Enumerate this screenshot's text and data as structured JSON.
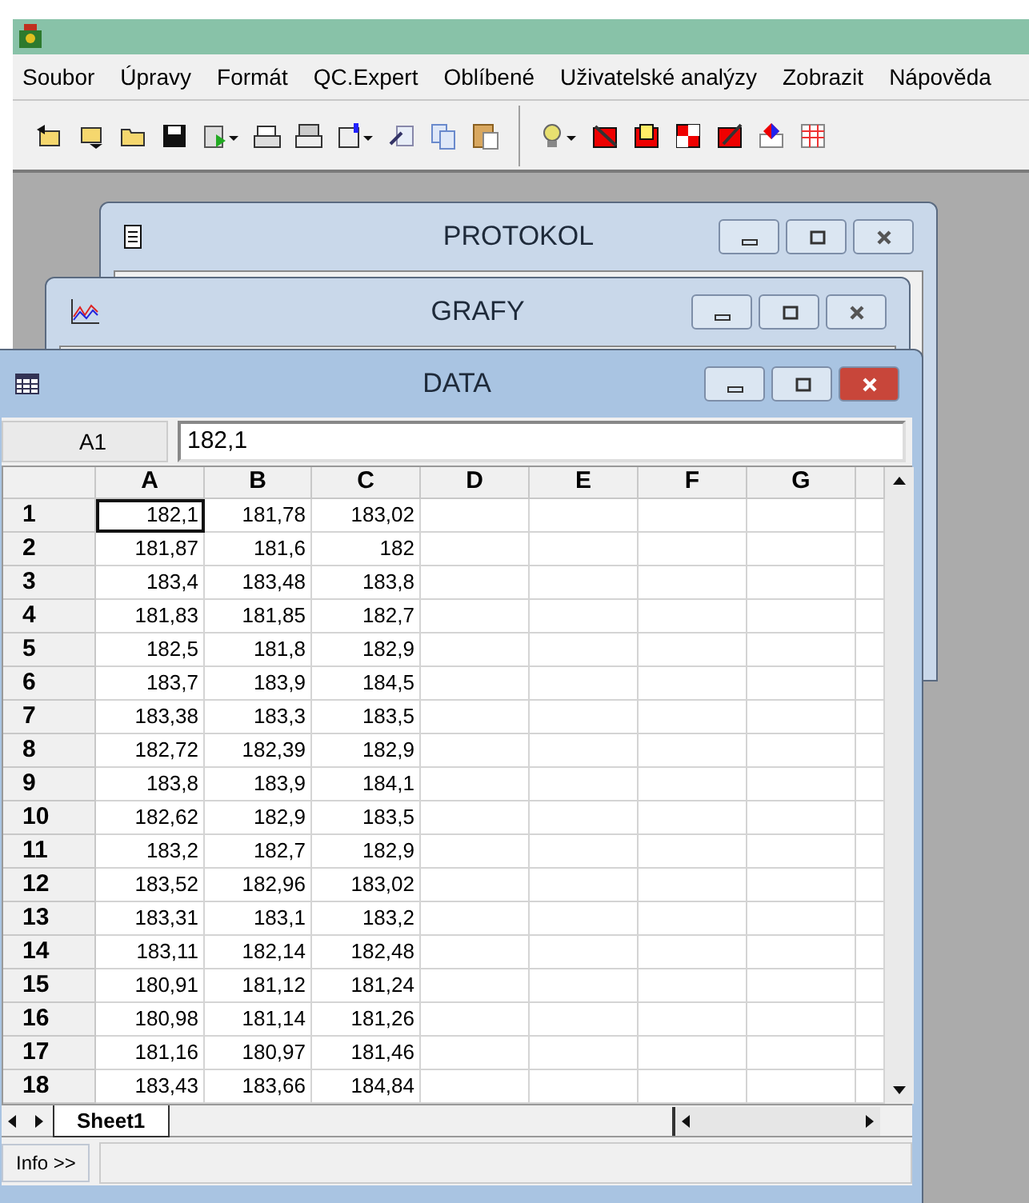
{
  "menu": [
    "Soubor",
    "Úpravy",
    "Formát",
    "QC.Expert",
    "Oblíbené",
    "Uživatelské analýzy",
    "Zobrazit",
    "Nápověda"
  ],
  "windows": [
    {
      "title": "PROTOKOL",
      "active": false
    },
    {
      "title": "GRAFY",
      "active": false
    },
    {
      "title": "DATA",
      "active": true
    }
  ],
  "sheet": {
    "name_box": "A1",
    "formula": "182,1",
    "columns": [
      "A",
      "B",
      "C",
      "D",
      "E",
      "F",
      "G"
    ],
    "rows": [
      {
        "header": "1",
        "cells": [
          {
            "value": "182,1",
            "selected": true
          },
          {
            "value": "181,78",
            "selected": false
          },
          {
            "value": "183,02",
            "selected": false
          }
        ]
      },
      {
        "header": "2",
        "cells": [
          {
            "value": "181,87",
            "selected": false
          },
          {
            "value": "181,6",
            "selected": false
          },
          {
            "value": "182",
            "selected": false
          }
        ]
      },
      {
        "header": "3",
        "cells": [
          {
            "value": "183,4",
            "selected": false
          },
          {
            "value": "183,48",
            "selected": false
          },
          {
            "value": "183,8",
            "selected": false
          }
        ]
      },
      {
        "header": "4",
        "cells": [
          {
            "value": "181,83",
            "selected": false
          },
          {
            "value": "181,85",
            "selected": false
          },
          {
            "value": "182,7",
            "selected": false
          }
        ]
      },
      {
        "header": "5",
        "cells": [
          {
            "value": "182,5",
            "selected": false
          },
          {
            "value": "181,8",
            "selected": false
          },
          {
            "value": "182,9",
            "selected": false
          }
        ]
      },
      {
        "header": "6",
        "cells": [
          {
            "value": "183,7",
            "selected": false
          },
          {
            "value": "183,9",
            "selected": false
          },
          {
            "value": "184,5",
            "selected": false
          }
        ]
      },
      {
        "header": "7",
        "cells": [
          {
            "value": "183,38",
            "selected": false
          },
          {
            "value": "183,3",
            "selected": false
          },
          {
            "value": "183,5",
            "selected": false
          }
        ]
      },
      {
        "header": "8",
        "cells": [
          {
            "value": "182,72",
            "selected": false
          },
          {
            "value": "182,39",
            "selected": false
          },
          {
            "value": "182,9",
            "selected": false
          }
        ]
      },
      {
        "header": "9",
        "cells": [
          {
            "value": "183,8",
            "selected": false
          },
          {
            "value": "183,9",
            "selected": false
          },
          {
            "value": "184,1",
            "selected": false
          }
        ]
      },
      {
        "header": "10",
        "cells": [
          {
            "value": "182,62",
            "selected": false
          },
          {
            "value": "182,9",
            "selected": false
          },
          {
            "value": "183,5",
            "selected": false
          }
        ]
      },
      {
        "header": "11",
        "cells": [
          {
            "value": "183,2",
            "selected": false
          },
          {
            "value": "182,7",
            "selected": false
          },
          {
            "value": "182,9",
            "selected": false
          }
        ]
      },
      {
        "header": "12",
        "cells": [
          {
            "value": "183,52",
            "selected": false
          },
          {
            "value": "182,96",
            "selected": false
          },
          {
            "value": "183,02",
            "selected": false
          }
        ]
      },
      {
        "header": "13",
        "cells": [
          {
            "value": "183,31",
            "selected": false
          },
          {
            "value": "183,1",
            "selected": false
          },
          {
            "value": "183,2",
            "selected": false
          }
        ]
      },
      {
        "header": "14",
        "cells": [
          {
            "value": "183,11",
            "selected": false
          },
          {
            "value": "182,14",
            "selected": false
          },
          {
            "value": "182,48",
            "selected": false
          }
        ]
      },
      {
        "header": "15",
        "cells": [
          {
            "value": "180,91",
            "selected": false
          },
          {
            "value": "181,12",
            "selected": false
          },
          {
            "value": "181,24",
            "selected": false
          }
        ]
      },
      {
        "header": "16",
        "cells": [
          {
            "value": "180,98",
            "selected": false
          },
          {
            "value": "181,14",
            "selected": false
          },
          {
            "value": "181,26",
            "selected": false
          }
        ]
      },
      {
        "header": "17",
        "cells": [
          {
            "value": "181,16",
            "selected": false
          },
          {
            "value": "180,97",
            "selected": false
          },
          {
            "value": "181,46",
            "selected": false
          }
        ]
      },
      {
        "header": "18",
        "cells": [
          {
            "value": "183,43",
            "selected": false
          },
          {
            "value": "183,66",
            "selected": false
          },
          {
            "value": "184,84",
            "selected": false
          }
        ]
      }
    ],
    "tabs": [
      {
        "label": "Sheet1",
        "selected": true
      }
    ]
  },
  "info_button": "Info >>"
}
